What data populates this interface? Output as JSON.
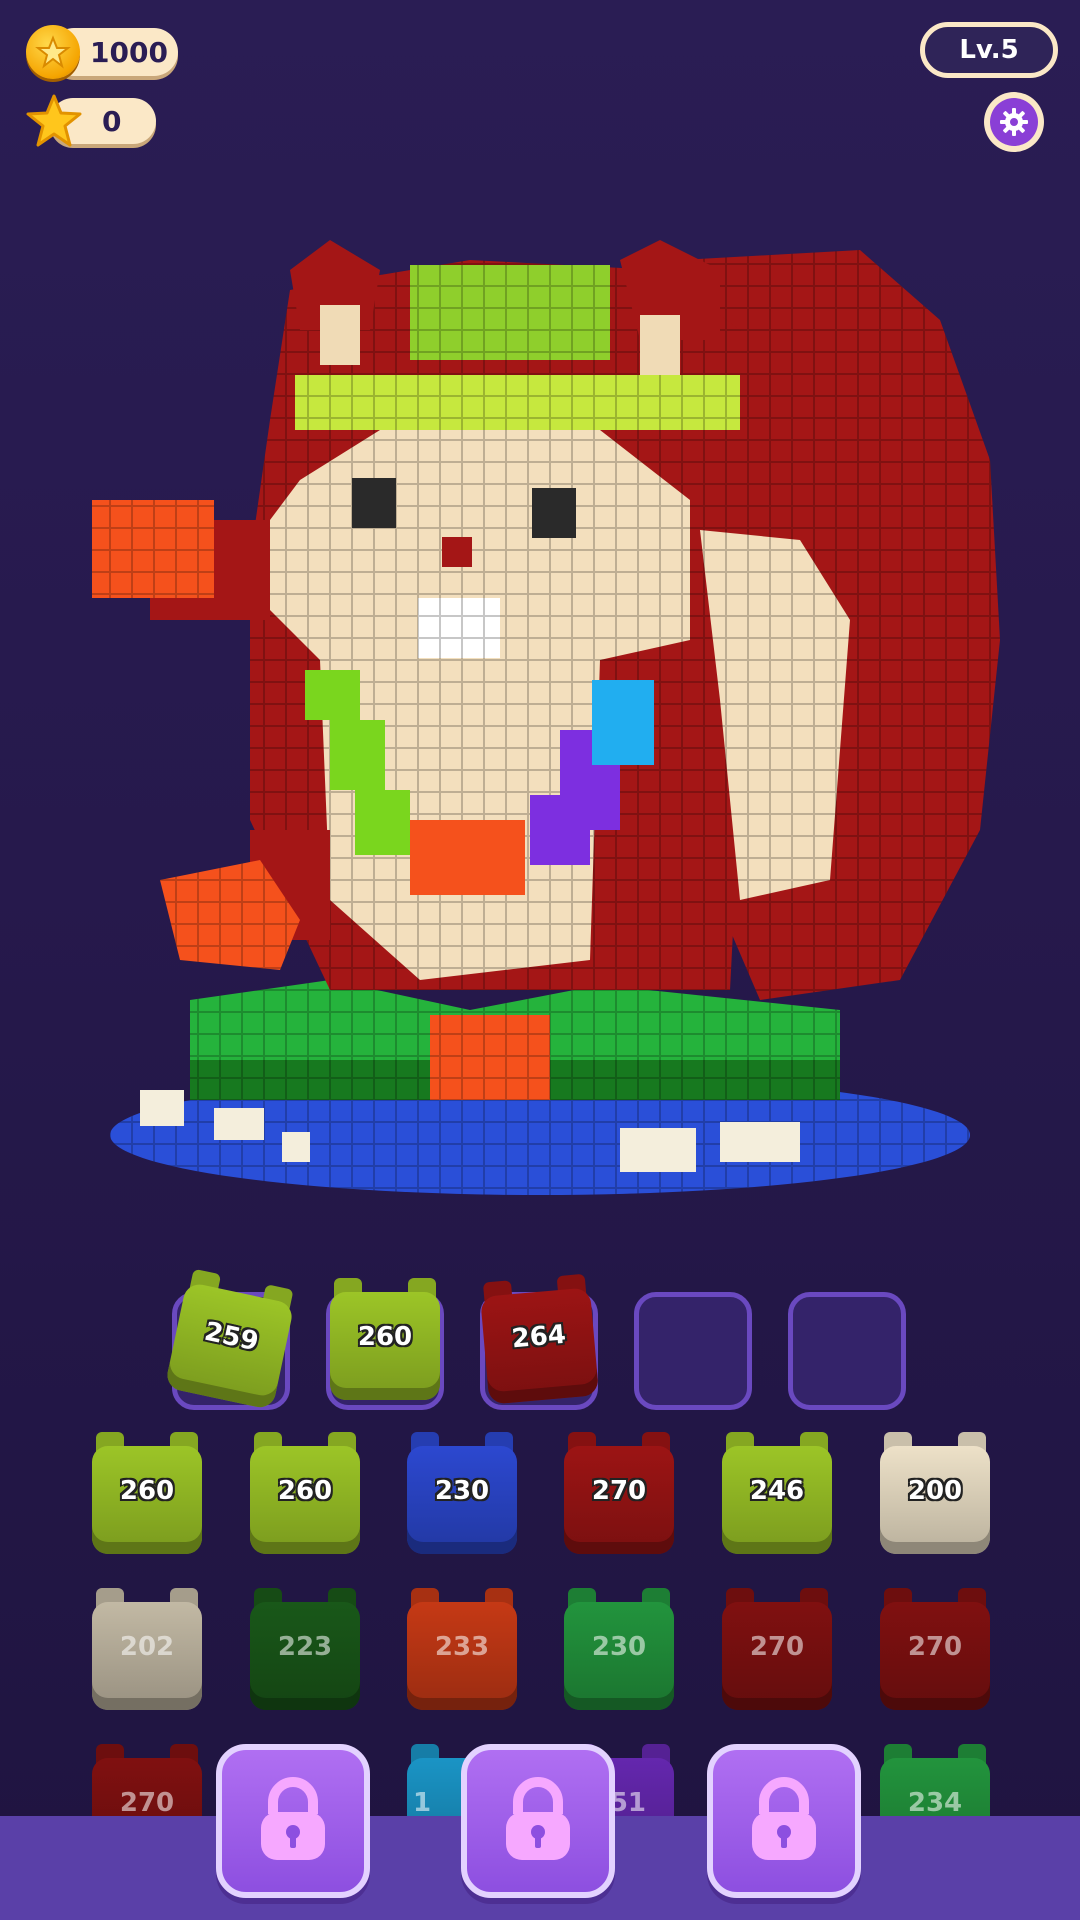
{
  "hud": {
    "coins": "1000",
    "stars": "0",
    "level": "Lv.5"
  },
  "colors": {
    "lime": "#9cc527",
    "blue": "#2c48d0",
    "red": "#9c1414",
    "cream": "#ede1c8",
    "darkgreen": "#1f6b1e",
    "orange": "#f0451a",
    "green": "#2ab54a",
    "cyan": "#20b4f0",
    "purple": "#7a2fd4",
    "slot_border": "#6a49c0",
    "lock_button": "#9a5ce8"
  },
  "tray": [
    {
      "label": "259",
      "color": "lime"
    },
    {
      "label": "260",
      "color": "lime"
    },
    {
      "label": "264",
      "color": "red"
    },
    {
      "label": "",
      "color": ""
    },
    {
      "label": "",
      "color": ""
    }
  ],
  "grid": {
    "row1": [
      {
        "label": "260",
        "color": "lime"
      },
      {
        "label": "260",
        "color": "lime"
      },
      {
        "label": "230",
        "color": "blue"
      },
      {
        "label": "270",
        "color": "red"
      },
      {
        "label": "246",
        "color": "lime"
      },
      {
        "label": "200",
        "color": "cream"
      }
    ],
    "row2": [
      {
        "label": "202",
        "color": "cream"
      },
      {
        "label": "223",
        "color": "darkgreen"
      },
      {
        "label": "233",
        "color": "orange"
      },
      {
        "label": "230",
        "color": "green"
      },
      {
        "label": "270",
        "color": "red"
      },
      {
        "label": "270",
        "color": "red"
      }
    ],
    "row3_visible": [
      {
        "label": "270",
        "color": "red"
      },
      {
        "label": "1",
        "color": "cyan"
      },
      {
        "label": "51",
        "color": "purple"
      },
      {
        "label": "234",
        "color": "green"
      }
    ]
  },
  "locks": [
    "padlock-icon",
    "padlock-icon",
    "padlock-icon"
  ]
}
